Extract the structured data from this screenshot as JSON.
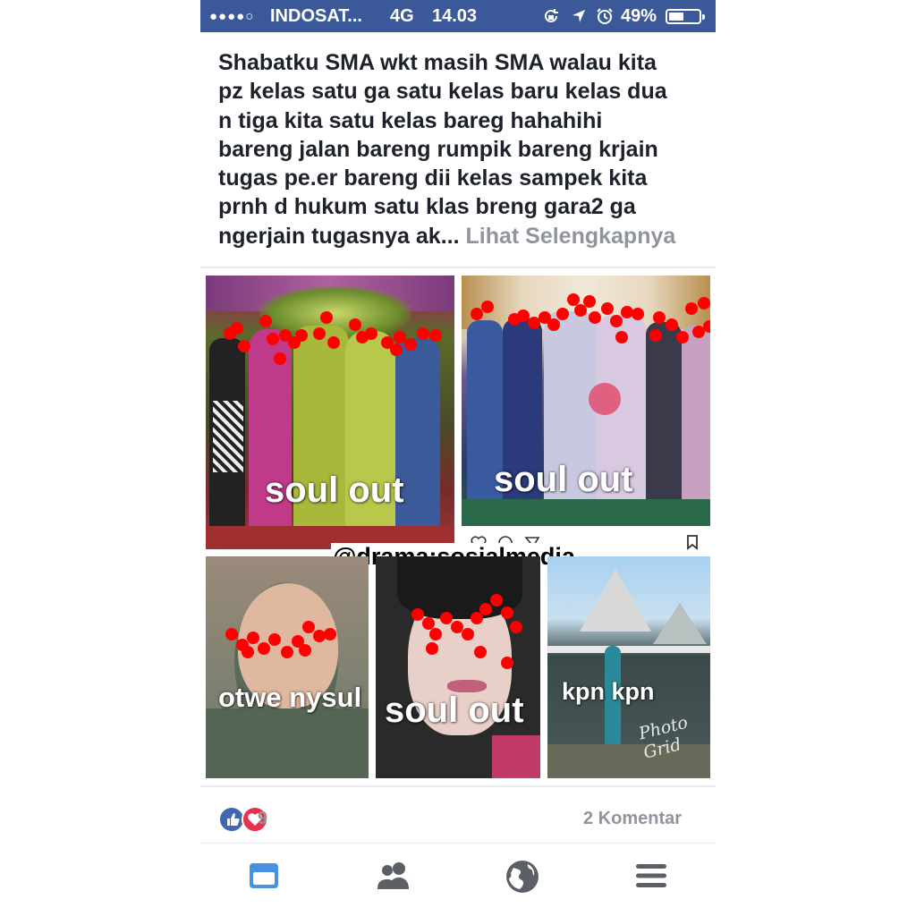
{
  "status_bar": {
    "signal": "●●●●○",
    "carrier": "INDOSAT...",
    "network": "4G",
    "time": "14.03",
    "battery_percent": "49%",
    "battery_level": 0.49,
    "icons": [
      "rotation-lock-icon",
      "location-arrow-icon",
      "alarm-icon"
    ]
  },
  "post": {
    "text_lines": [
      "Shabatku SMA wkt masih SMA walau kita",
      "pz kelas satu ga satu kelas baru kelas dua",
      "n tiga kita satu kelas bareg hahahihi",
      "bareng jalan bareng rumpik bareng krjain",
      "tugas pe.er bareng dii kelas sampek kita",
      "prnh d hukum satu klas breng gara2 ga",
      "ngerjain tugasnya ak..."
    ],
    "see_more": "Lihat Selengkapnya",
    "photos": [
      {
        "caption": "soul out"
      },
      {
        "caption": "soul out"
      },
      {
        "caption": "otwe nysul"
      },
      {
        "caption": "soul out"
      },
      {
        "caption": "kpn kpn",
        "stamp": "Photo Grid"
      }
    ],
    "watermark": "@drama:sosialmedia",
    "reaction_icons": [
      "like-icon",
      "love-icon"
    ],
    "reaction_count": "9",
    "comments": "2 Komentar"
  },
  "tab_bar": {
    "items": [
      "news-feed-icon",
      "friends-icon",
      "globe-icon",
      "menu-icon"
    ],
    "active_color": "#4a90e2",
    "inactive_color": "#5b5f66"
  },
  "colors": {
    "status_bar": "#3b5998",
    "redaction": "#ff0000",
    "like": "#4267b2",
    "love": "#e8314b"
  }
}
